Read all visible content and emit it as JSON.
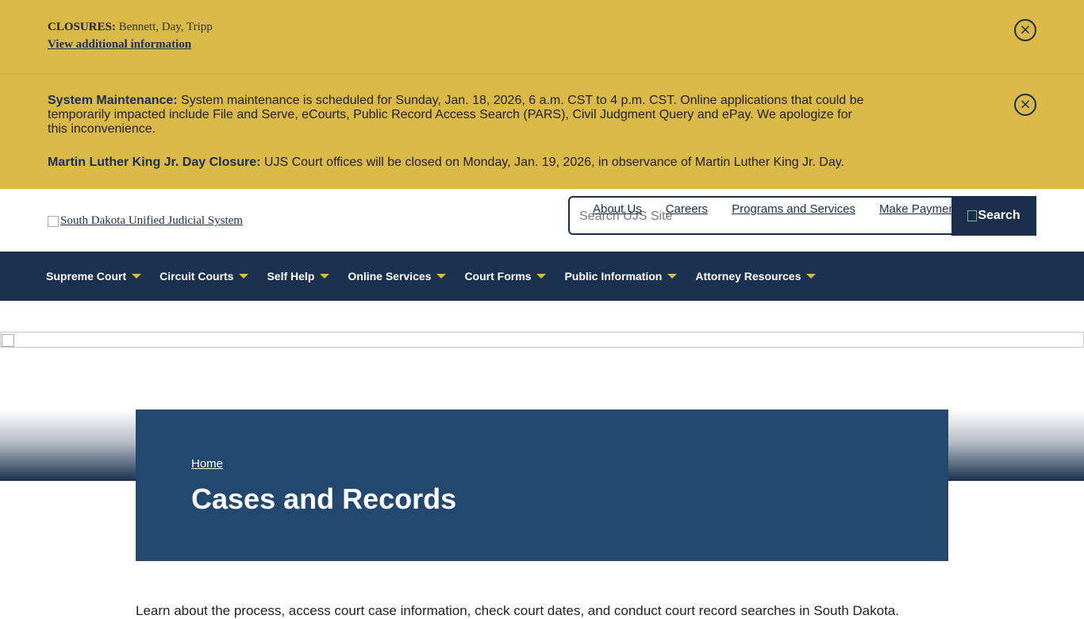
{
  "alerts": {
    "closures": {
      "label": "CLOSURES:",
      "text": " Bennett, Day, Tripp",
      "link": "View additional information",
      "close_icon": "×"
    },
    "maintenance": {
      "label": "System Maintenance:",
      "text": " System maintenance is scheduled for Sunday, Jan. 18, 2026, 6 a.m. CST to 4 p.m. CST. Online applications that could be temporarily impacted include File and Serve, eCourts, Public Record Access Search (PARS), Civil Judgment Query and ePay. We apologize for this inconvenience.",
      "mlk_label": "Martin Luther King Jr. Day Closure:",
      "mlk_text": " UJS Court offices will be closed on Monday, Jan. 19, 2026, in observance of Martin Luther King Jr. Day.",
      "close_icon": "×"
    }
  },
  "header": {
    "logo_alt": "South Dakota Unified Judicial System",
    "search_placeholder": "Search UJS Site",
    "search_button": "Search",
    "util_links": [
      "About Us",
      "Careers",
      "Programs and Services",
      "Make Payment"
    ]
  },
  "nav": {
    "items": [
      "Supreme Court",
      "Circuit Courts",
      "Self Help",
      "Online Services",
      "Court Forms",
      "Public Information",
      "Attorney Resources"
    ]
  },
  "hero": {
    "breadcrumb": "Home",
    "title": "Cases and Records"
  },
  "intro": {
    "text": "Learn about the process, access court case information, check court dates, and conduct court record searches in South Dakota."
  },
  "colors": {
    "alert_bg": "#dbb947",
    "navy": "#1a3150",
    "hero_bg": "#234870",
    "caret": "#dbb947"
  }
}
